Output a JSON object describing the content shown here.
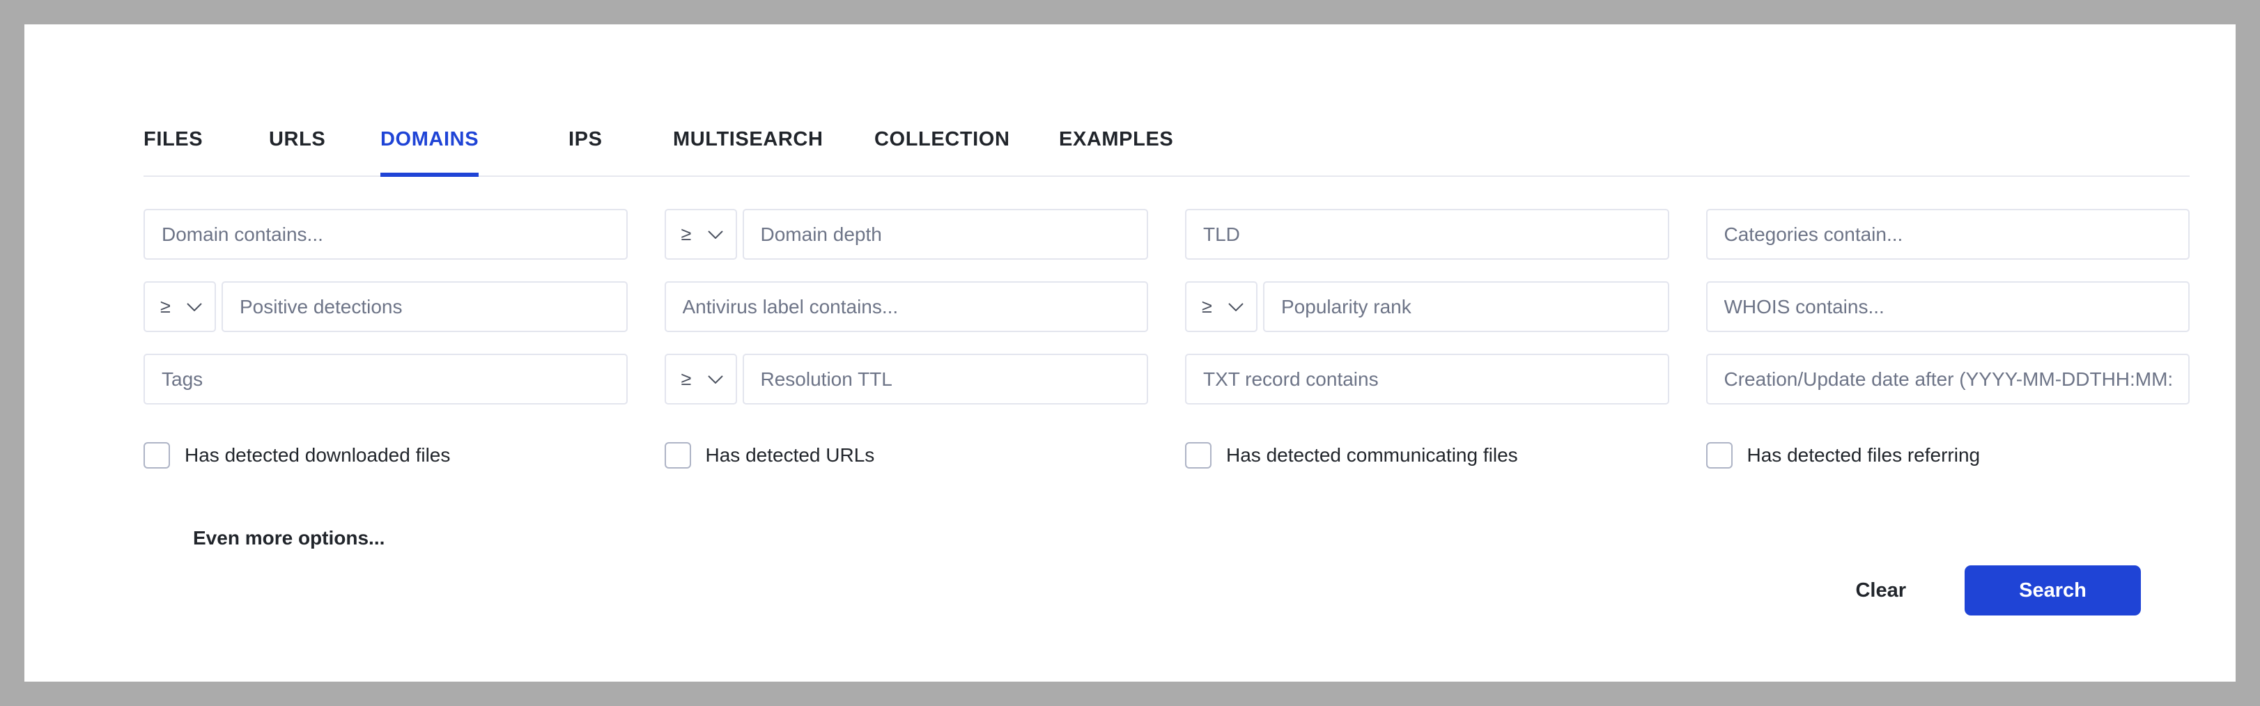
{
  "theme": {
    "accent": "#1f44d6",
    "page_background": "#ababab",
    "card_background": "#ffffff",
    "field_border": "#e3e5ee",
    "placeholder_color": "#6d7487",
    "text_color": "#21252b"
  },
  "tabs": [
    {
      "label": "FILES",
      "active": false
    },
    {
      "label": "URLS",
      "active": false
    },
    {
      "label": "DOMAINS",
      "active": true
    },
    {
      "label": "IPS",
      "active": false
    },
    {
      "label": "MULTISEARCH",
      "active": false
    },
    {
      "label": "COLLECTION",
      "active": false
    },
    {
      "label": "EXAMPLES",
      "active": false
    }
  ],
  "fields": {
    "row1": [
      {
        "name": "domain-contains",
        "placeholder": "Domain contains...",
        "value": "",
        "operator": null
      },
      {
        "name": "domain-depth",
        "placeholder": "Domain depth",
        "value": "",
        "operator": "≥"
      },
      {
        "name": "tld",
        "placeholder": "TLD",
        "value": "",
        "operator": null
      },
      {
        "name": "categories-contain",
        "placeholder": "Categories contain...",
        "value": "",
        "operator": null
      }
    ],
    "row2": [
      {
        "name": "positive-detections",
        "placeholder": "Positive detections",
        "value": "",
        "operator": "≥"
      },
      {
        "name": "antivirus-label-contains",
        "placeholder": "Antivirus label contains...",
        "value": "",
        "operator": null
      },
      {
        "name": "popularity-rank",
        "placeholder": "Popularity rank",
        "value": "",
        "operator": "≥"
      },
      {
        "name": "whois-contains",
        "placeholder": "WHOIS contains...",
        "value": "",
        "operator": null
      }
    ],
    "row3": [
      {
        "name": "tags",
        "placeholder": "Tags",
        "value": "",
        "operator": null
      },
      {
        "name": "resolution-ttl",
        "placeholder": "Resolution TTL",
        "value": "",
        "operator": "≥"
      },
      {
        "name": "txt-record-contains",
        "placeholder": "TXT record contains",
        "value": "",
        "operator": null
      },
      {
        "name": "creation-update-date-after",
        "placeholder": "Creation/Update date after (YYYY-MM-DDTHH:MM:SS)",
        "value": "",
        "operator": null
      }
    ]
  },
  "checkboxes": [
    {
      "name": "has-detected-downloaded-files",
      "label": "Has detected downloaded files",
      "checked": false
    },
    {
      "name": "has-detected-urls",
      "label": "Has detected URLs",
      "checked": false
    },
    {
      "name": "has-detected-communicating-files",
      "label": "Has detected communicating files",
      "checked": false
    },
    {
      "name": "has-detected-files-referring",
      "label": "Has detected files referring",
      "checked": false
    }
  ],
  "more_options_label": "Even more options...",
  "actions": {
    "clear_label": "Clear",
    "search_label": "Search"
  }
}
